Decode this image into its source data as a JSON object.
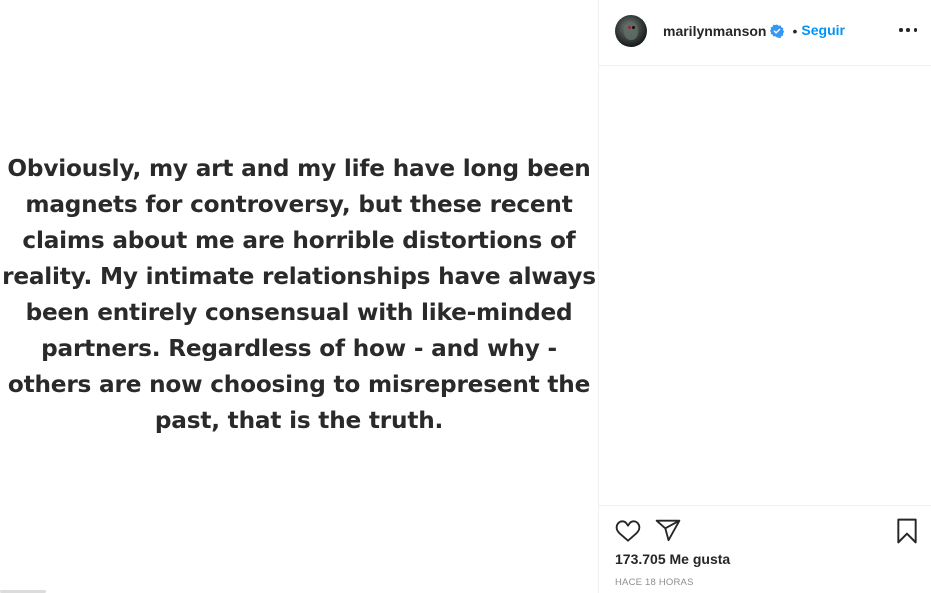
{
  "post": {
    "statement": "Obviously, my art and my life have long been magnets for controversy, but these recent claims about me are horrible distortions of reality. My intimate relationships have always been entirely consensual with like-minded partners. Regardless of how - and why - others are now choosing to misrepresent the past, that is the truth."
  },
  "header": {
    "username": "marilynmanson",
    "verified_icon": "verified-badge-icon",
    "separator": "•",
    "follow_label": "Seguir",
    "more_icon": "more-options-icon"
  },
  "actions": {
    "like_icon": "heart-icon",
    "share_icon": "paper-plane-icon",
    "save_icon": "bookmark-icon",
    "likes_count": "173.705",
    "likes_label": "Me gusta",
    "timestamp": "HACE 18 HORAS"
  },
  "colors": {
    "accent": "#0095f6",
    "text": "#262626",
    "muted": "#8e8e8e",
    "border": "#efefef"
  }
}
